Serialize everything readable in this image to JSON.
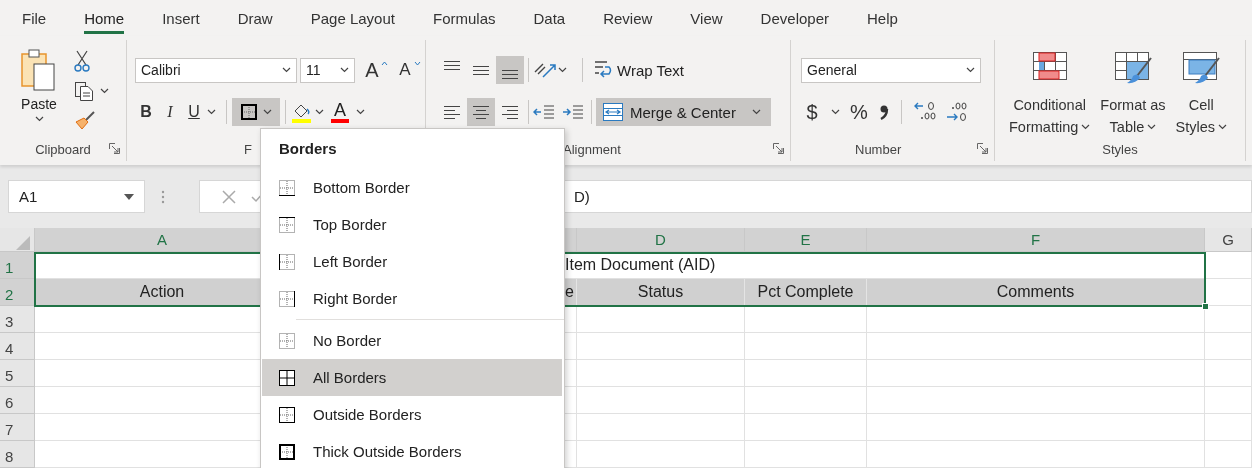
{
  "tabs": [
    {
      "label": "File",
      "selected": false
    },
    {
      "label": "Home",
      "selected": true
    },
    {
      "label": "Insert",
      "selected": false
    },
    {
      "label": "Draw",
      "selected": false
    },
    {
      "label": "Page Layout",
      "selected": false
    },
    {
      "label": "Formulas",
      "selected": false
    },
    {
      "label": "Data",
      "selected": false
    },
    {
      "label": "Review",
      "selected": false
    },
    {
      "label": "View",
      "selected": false
    },
    {
      "label": "Developer",
      "selected": false
    },
    {
      "label": "Help",
      "selected": false
    }
  ],
  "ribbon": {
    "clipboard": {
      "paste": "Paste",
      "label": "Clipboard"
    },
    "font": {
      "font_name": "Calibri",
      "font_size": "11",
      "grow": "A",
      "shrink": "A",
      "styles": [
        {
          "kind": "bold",
          "glyph": "B"
        },
        {
          "kind": "italic",
          "glyph": "I"
        },
        {
          "kind": "underline",
          "glyph": "U"
        }
      ],
      "borders_pressed": true,
      "font_color_glyph": "A",
      "label": "F"
    },
    "alignment": {
      "vertical": [
        {
          "kind": "top",
          "pressed": false
        },
        {
          "kind": "middle",
          "pressed": false
        },
        {
          "kind": "bottom",
          "pressed": true
        }
      ],
      "horizontal": [
        {
          "kind": "left",
          "pressed": false
        },
        {
          "kind": "center",
          "pressed": true
        },
        {
          "kind": "right",
          "pressed": false
        }
      ],
      "wrap_text": {
        "label": "Wrap Text",
        "pressed": false
      },
      "merge_center": {
        "label": "Merge & Center",
        "pressed": true
      },
      "label": "Alignment"
    },
    "number": {
      "format": "General",
      "currency": "$",
      "percent": "%",
      "label": "Number"
    },
    "styles": {
      "buttons": [
        {
          "kind": "conditional",
          "lines": [
            "Conditional",
            "Formatting"
          ]
        },
        {
          "kind": "table",
          "lines": [
            "Format as",
            "Table"
          ]
        },
        {
          "kind": "cell",
          "lines": [
            "Cell",
            "Styles"
          ]
        }
      ],
      "label": "Styles"
    }
  },
  "formula_bar": {
    "name_box": "A1",
    "formula": "D)"
  },
  "sheet": {
    "columns": [
      {
        "label": "A",
        "selected": true
      },
      {
        "selected": true
      },
      {
        "label": "D",
        "selected": true
      },
      {
        "label": "E",
        "selected": true
      },
      {
        "label": "F",
        "selected": true
      },
      {
        "label": "G",
        "selected": false
      }
    ],
    "rows": [
      {
        "header": "1",
        "selected": true,
        "kind": "merged",
        "text": "Item Document (AID)"
      },
      {
        "header": "2",
        "selected": true,
        "kind": "headings",
        "cells": [
          "Action",
          "e",
          "Status",
          "Pct Complete",
          "Comments"
        ]
      },
      {
        "header": "3",
        "selected": false,
        "kind": "blank"
      },
      {
        "header": "4",
        "selected": false,
        "kind": "blank"
      },
      {
        "header": "5",
        "selected": false,
        "kind": "blank"
      },
      {
        "header": "6",
        "selected": false,
        "kind": "blank"
      },
      {
        "header": "7",
        "selected": false,
        "kind": "blank"
      },
      {
        "header": "8",
        "selected": false,
        "kind": "blank"
      }
    ]
  },
  "borders_menu": {
    "title": "Borders",
    "groups": [
      {
        "items": [
          {
            "label": "Bottom Border",
            "kind": "bottom",
            "selected": false
          },
          {
            "label": "Top Border",
            "kind": "top",
            "selected": false
          },
          {
            "label": "Left Border",
            "kind": "left",
            "selected": false
          },
          {
            "label": "Right Border",
            "kind": "right",
            "selected": false
          }
        ]
      },
      {
        "items": [
          {
            "label": "No Border",
            "kind": "none",
            "selected": false
          },
          {
            "label": "All Borders",
            "kind": "all",
            "selected": true
          },
          {
            "label": "Outside Borders",
            "kind": "outside",
            "selected": false
          },
          {
            "label": "Thick Outside Borders",
            "kind": "thick",
            "selected": false
          }
        ]
      }
    ]
  }
}
